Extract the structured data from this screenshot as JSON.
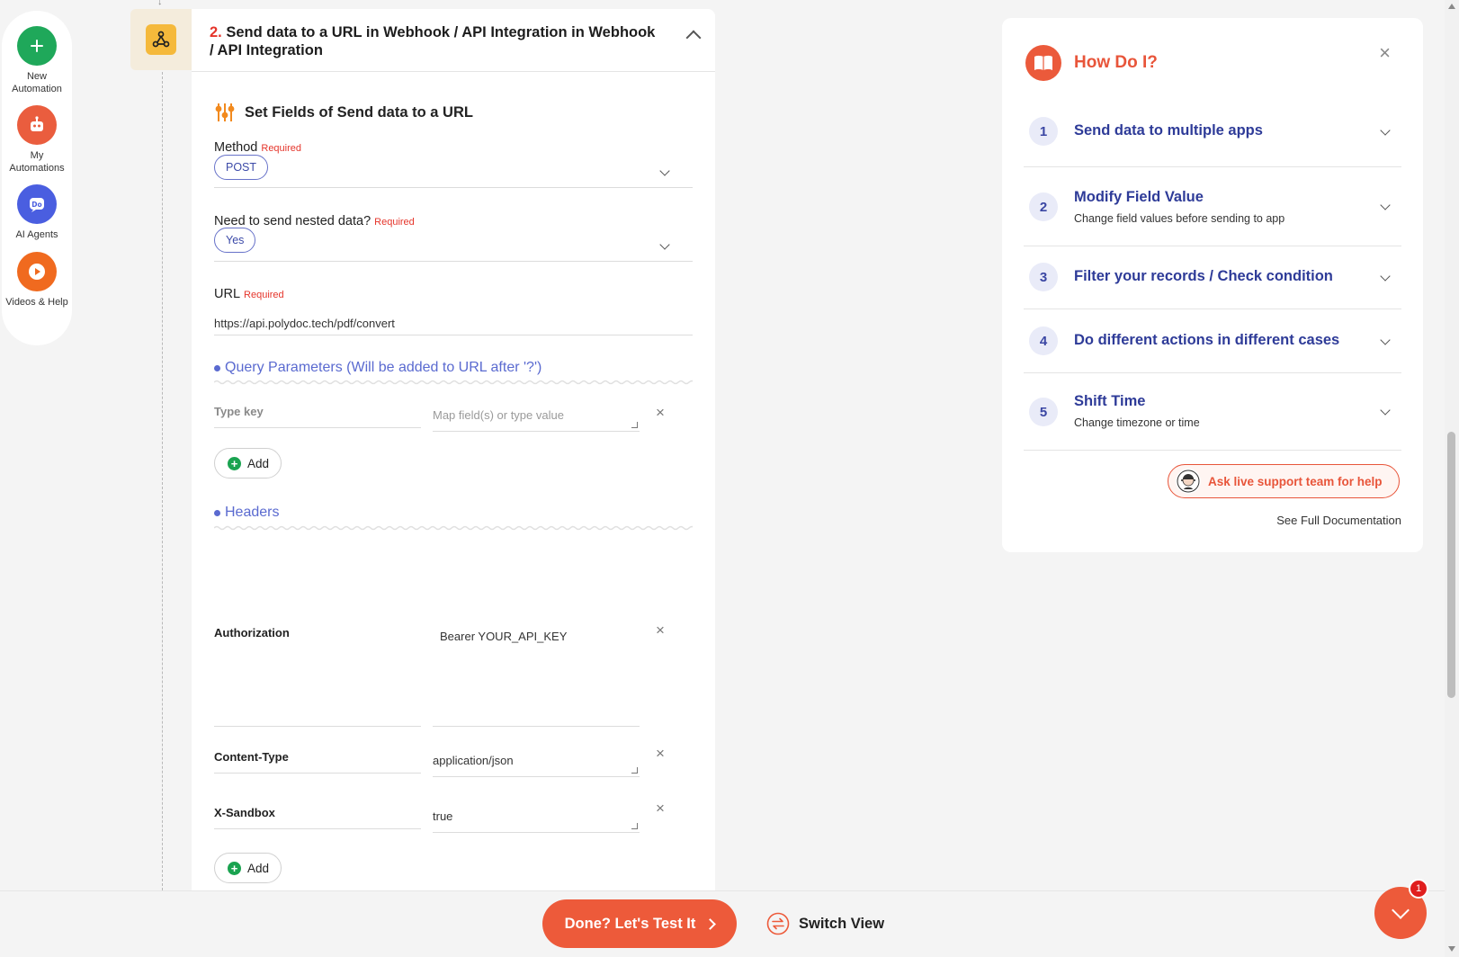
{
  "nav": {
    "items": [
      {
        "label": "New Automation",
        "icon": "plus-icon",
        "color": "#1fa85a"
      },
      {
        "label": "My Automations",
        "icon": "robot-icon",
        "color": "#ea5d3e"
      },
      {
        "label": "AI Agents",
        "icon": "ai-agent-icon",
        "color": "#4a5ee0"
      },
      {
        "label": "Videos & Help",
        "icon": "play-icon",
        "color": "#f06a1f"
      }
    ]
  },
  "step": {
    "number": "2.",
    "title": "Send data to a URL in Webhook / API Integration in Webhook / API Integration",
    "icon": "webhook-icon"
  },
  "fields": {
    "section_title": "Set Fields of Send data to a URL",
    "required_label": "Required",
    "method": {
      "label": "Method",
      "value": "POST"
    },
    "nested": {
      "label": "Need to send nested data?",
      "value": "Yes"
    },
    "url": {
      "label": "URL",
      "value": "https://api.polydoc.tech/pdf/convert"
    },
    "query": {
      "title": "Query Parameters (Will be added to URL after '?')",
      "key_placeholder": "Type key",
      "value_placeholder": "Map field(s) or type value",
      "add_label": "Add"
    },
    "headers": {
      "title": "Headers",
      "rows": [
        {
          "key": "Authorization",
          "value": "Bearer YOUR_API_KEY"
        },
        {
          "key": "Content-Type",
          "value": "application/json"
        },
        {
          "key": "X-Sandbox",
          "value": "true"
        }
      ],
      "add_label": "Add"
    }
  },
  "help": {
    "title": "How Do I?",
    "items": [
      {
        "num": "1",
        "title": "Send data to multiple apps",
        "sub": ""
      },
      {
        "num": "2",
        "title": "Modify Field Value",
        "sub": "Change field values before sending to app"
      },
      {
        "num": "3",
        "title": "Filter your records / Check condition",
        "sub": ""
      },
      {
        "num": "4",
        "title": "Do different actions in different cases",
        "sub": ""
      },
      {
        "num": "5",
        "title": "Shift Time",
        "sub": "Change timezone or time"
      }
    ],
    "support_label": "Ask live support team for help",
    "docs_label": "See Full Documentation"
  },
  "footer": {
    "done_label": "Done? Let's Test It",
    "switch_label": "Switch View",
    "badge_count": "1"
  },
  "colors": {
    "accent": "#ed5a3a",
    "link_blue": "#5a6ad0",
    "heading_blue": "#2e3b98"
  }
}
